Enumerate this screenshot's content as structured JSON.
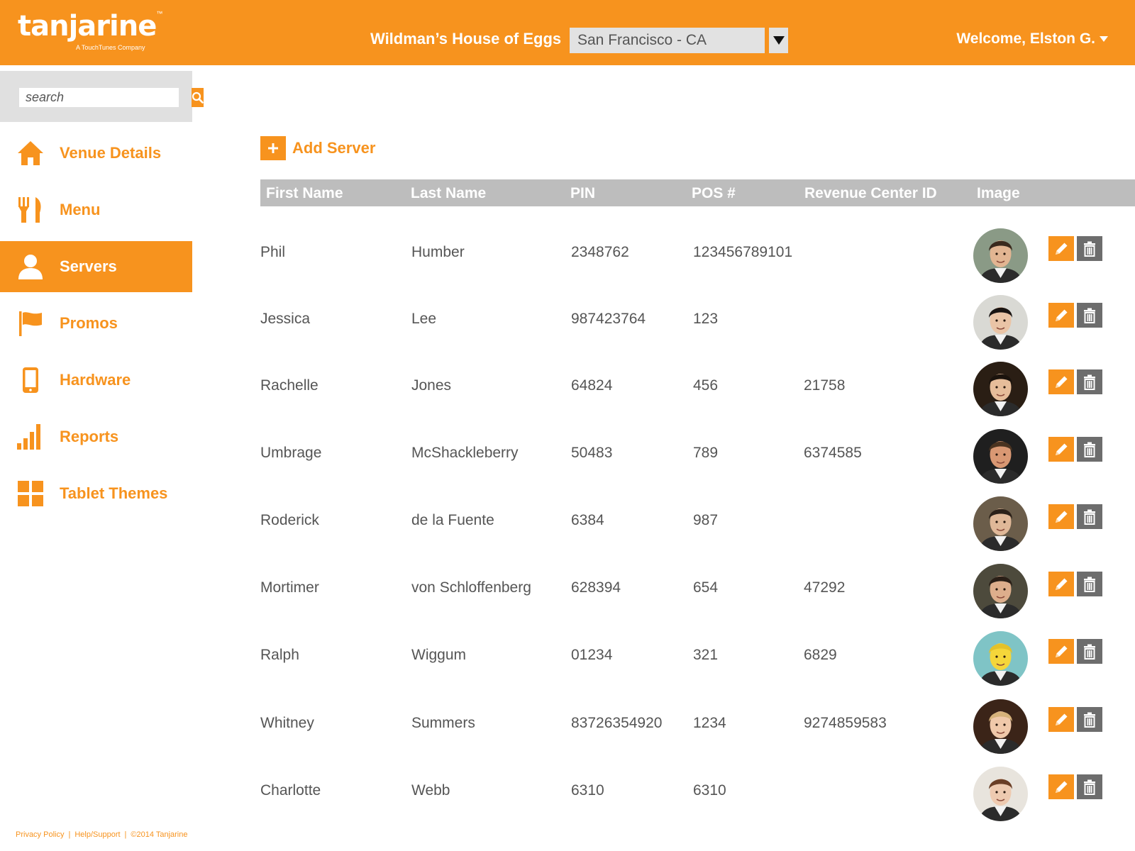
{
  "header": {
    "logo_word": "tanjarine",
    "logo_tm": "™",
    "logo_sub": "A TouchTunes Company",
    "venue_name": "Wildman’s House of Eggs",
    "location": "San Francisco - CA",
    "welcome": "Welcome, Elston G.",
    "brand_color": "#f7931e"
  },
  "search": {
    "placeholder": "search"
  },
  "nav": [
    {
      "label": "Venue Details",
      "icon": "home-icon",
      "active": false
    },
    {
      "label": "Menu",
      "icon": "fork-knife-icon",
      "active": false
    },
    {
      "label": "Servers",
      "icon": "person-icon",
      "active": true
    },
    {
      "label": "Promos",
      "icon": "flag-icon",
      "active": false
    },
    {
      "label": "Hardware",
      "icon": "tablet-icon",
      "active": false
    },
    {
      "label": "Reports",
      "icon": "bar-chart-icon",
      "active": false
    },
    {
      "label": "Tablet Themes",
      "icon": "grid-icon",
      "active": false
    }
  ],
  "footer": {
    "privacy": "Privacy Policy",
    "help": "Help/Support",
    "copyright": "©2014 Tanjarine",
    "separator": "|"
  },
  "main": {
    "add_server": "Add Server",
    "columns": [
      "First Name",
      "Last Name",
      "PIN",
      "POS #",
      "Revenue Center ID",
      "Image"
    ],
    "servers": [
      {
        "first": "Phil",
        "last": "Humber",
        "pin": "2348762",
        "pos": "123456789101",
        "revenue": "",
        "avatar_bg": "#8a9a86",
        "skin": "#e2b592",
        "hair": "#3a2a1e"
      },
      {
        "first": "Jessica",
        "last": "Lee",
        "pin": "987423764",
        "pos": "123",
        "revenue": "",
        "avatar_bg": "#d9d9d4",
        "skin": "#eac4a6",
        "hair": "#1a1412"
      },
      {
        "first": "Rachelle",
        "last": "Jones",
        "pin": "64824",
        "pos": "456",
        "revenue": "21758",
        "avatar_bg": "#2a1e14",
        "skin": "#e6bd9a",
        "hair": "#1b130d"
      },
      {
        "first": "Umbrage",
        "last": "McShackleberry",
        "pin": "50483",
        "pos": "789",
        "revenue": "6374585",
        "avatar_bg": "#1f1f1f",
        "skin": "#d99873",
        "hair": "#4a3320"
      },
      {
        "first": "Roderick",
        "last": "de la Fuente",
        "pin": "6384",
        "pos": "987",
        "revenue": "",
        "avatar_bg": "#6b5d4a",
        "skin": "#e0b898",
        "hair": "#2c2119"
      },
      {
        "first": "Mortimer",
        "last": "von Schloffenberg",
        "pin": "628394",
        "pos": "654",
        "revenue": "47292",
        "avatar_bg": "#4d4a3c",
        "skin": "#ddae8c",
        "hair": "#2a1f17"
      },
      {
        "first": "Ralph",
        "last": "Wiggum",
        "pin": "01234",
        "pos": "321",
        "revenue": "6829",
        "avatar_bg": "#7fc4c6",
        "skin": "#f5d63a",
        "hair": "#e3c12a"
      },
      {
        "first": "Whitney",
        "last": "Summers",
        "pin": "83726354920",
        "pos": "1234",
        "revenue": "9274859583",
        "avatar_bg": "#3b2418",
        "skin": "#f0c9aa",
        "hair": "#d6b27a"
      },
      {
        "first": "Charlotte",
        "last": "Webb",
        "pin": "6310",
        "pos": "6310",
        "revenue": "",
        "avatar_bg": "#e8e4dd",
        "skin": "#eecab0",
        "hair": "#6a3e26"
      }
    ]
  }
}
